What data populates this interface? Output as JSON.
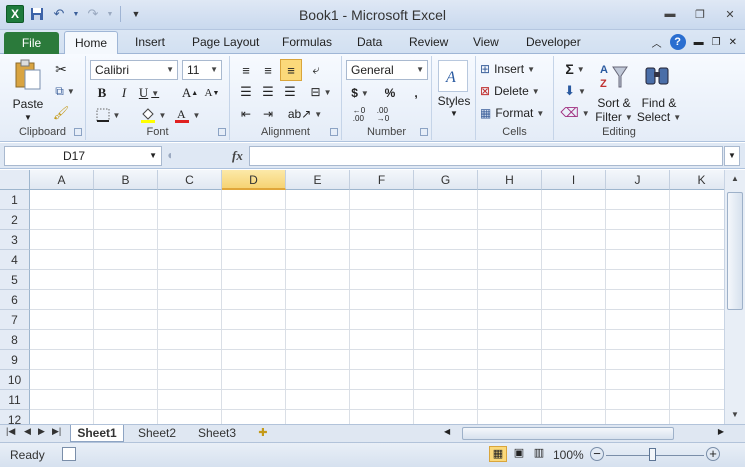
{
  "title_bar": {
    "title": "Book1 - Microsoft Excel",
    "app_icon": "X",
    "save_icon": "save-icon",
    "undo_icon": "undo-icon",
    "redo_icon": "redo-icon"
  },
  "tabs": {
    "file": "File",
    "items": [
      "Home",
      "Insert",
      "Page Layout",
      "Formulas",
      "Data",
      "Review",
      "View",
      "Developer"
    ],
    "active": "Home"
  },
  "ribbon": {
    "clipboard": {
      "label": "Clipboard",
      "paste": "Paste"
    },
    "font": {
      "label": "Font",
      "name": "Calibri",
      "size": "11"
    },
    "alignment": {
      "label": "Alignment"
    },
    "number": {
      "label": "Number",
      "format": "General",
      "currency": "$",
      "percent": "%",
      "comma": ","
    },
    "styles": {
      "label": "Styles"
    },
    "cells": {
      "label": "Cells",
      "insert": "Insert",
      "delete": "Delete",
      "format": "Format"
    },
    "editing": {
      "label": "Editing",
      "sort1": "Sort &",
      "sort2": "Filter",
      "find1": "Find &",
      "find2": "Select"
    }
  },
  "formula_bar": {
    "name_box": "D17",
    "fx": "fx",
    "value": ""
  },
  "grid": {
    "columns": [
      "A",
      "B",
      "C",
      "D",
      "E",
      "F",
      "G",
      "H",
      "I",
      "J",
      "K"
    ],
    "selected_column": "D",
    "rows": [
      "1",
      "2",
      "3",
      "4",
      "5",
      "6",
      "7",
      "8",
      "9",
      "10",
      "11",
      "12"
    ]
  },
  "sheets": {
    "items": [
      "Sheet1",
      "Sheet2",
      "Sheet3"
    ],
    "active": "Sheet1"
  },
  "status_bar": {
    "status": "Ready",
    "zoom": "100%",
    "zoom_level": 100
  },
  "colors": {
    "file_tab": "#2b7a3b",
    "selected_header": "#f6d374",
    "accent": "#2a6ed0"
  }
}
